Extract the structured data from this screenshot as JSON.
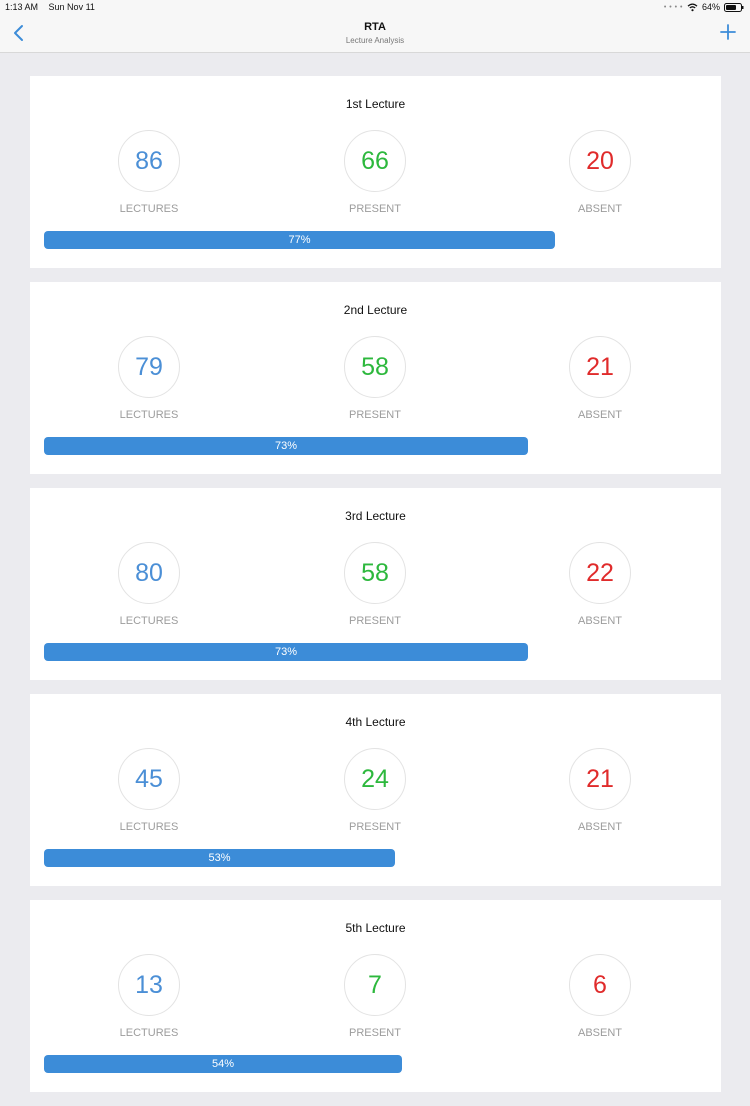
{
  "status_bar": {
    "time": "1:13 AM",
    "date": "Sun Nov 11",
    "battery": "64%",
    "icons": [
      "wifi-icon",
      "battery-icon"
    ]
  },
  "nav": {
    "title": "RTA",
    "subtitle": "Lecture Analysis",
    "icons": [
      "chevron-left-icon",
      "plus-icon"
    ]
  },
  "colors": {
    "accent": "#3c8cd8",
    "lectures": "#4b8fd6",
    "present": "#2db83d",
    "absent": "#e02b2b"
  },
  "lectures": [
    {
      "title": "1st Lecture",
      "lectures": "86",
      "present": "66",
      "absent": "20",
      "lectures_label": "LECTURES",
      "present_label": "PRESENT",
      "absent_label": "ABSENT",
      "percent": "77%",
      "progress": 0.77
    },
    {
      "title": "2nd Lecture",
      "lectures": "79",
      "present": "58",
      "absent": "21",
      "lectures_label": "LECTURES",
      "present_label": "PRESENT",
      "absent_label": "ABSENT",
      "percent": "73%",
      "progress": 0.73
    },
    {
      "title": "3rd Lecture",
      "lectures": "80",
      "present": "58",
      "absent": "22",
      "lectures_label": "LECTURES",
      "present_label": "PRESENT",
      "absent_label": "ABSENT",
      "percent": "73%",
      "progress": 0.73
    },
    {
      "title": "4th Lecture",
      "lectures": "45",
      "present": "24",
      "absent": "21",
      "lectures_label": "LECTURES",
      "present_label": "PRESENT",
      "absent_label": "ABSENT",
      "percent": "53%",
      "progress": 0.53
    },
    {
      "title": "5th Lecture",
      "lectures": "13",
      "present": "7",
      "absent": "6",
      "lectures_label": "LECTURES",
      "present_label": "PRESENT",
      "absent_label": "ABSENT",
      "percent": "54%",
      "progress": 0.54
    }
  ]
}
